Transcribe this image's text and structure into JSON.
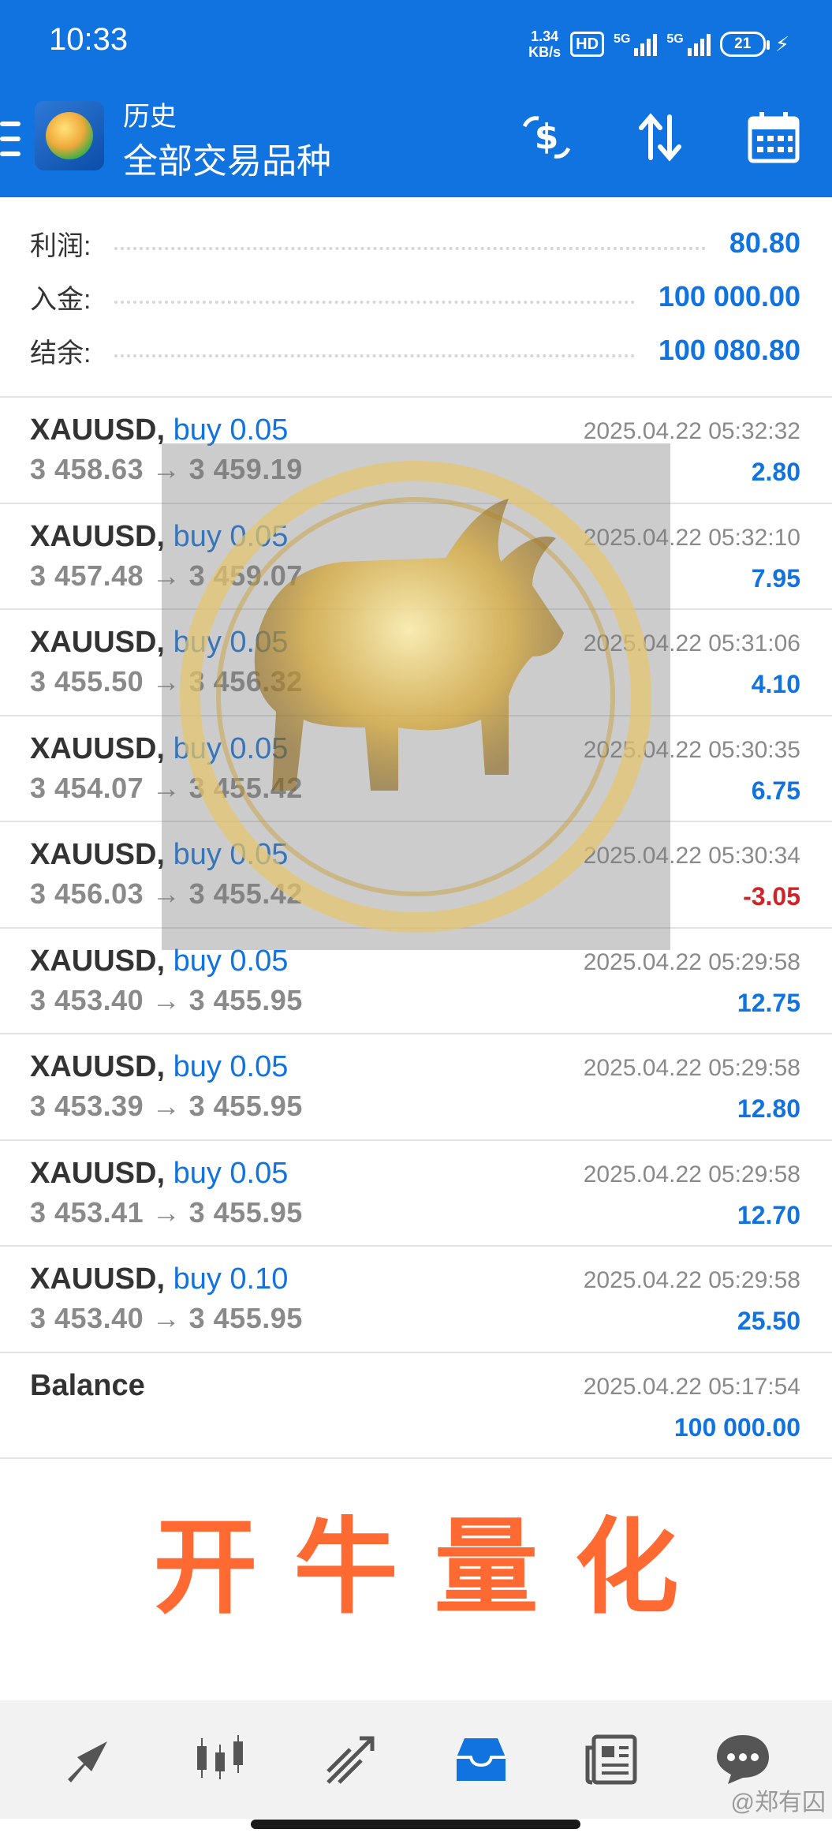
{
  "status": {
    "time": "10:33",
    "net_speed_value": "1.34",
    "net_speed_unit": "KB/s",
    "hd": "HD",
    "sim1": "5G",
    "sim2": "5G",
    "battery": "21"
  },
  "appbar": {
    "title_small": "历史",
    "title_main": "全部交易品种"
  },
  "summary": {
    "profit_label": "利润:",
    "profit_value": "80.80",
    "deposit_label": "入金:",
    "deposit_value": "100 000.00",
    "balance_label": "结余:",
    "balance_value": "100 080.80"
  },
  "deals": [
    {
      "symbol": "XAUUSD,",
      "side": "buy 0.05",
      "prices": "3 458.63 → 3 459.19",
      "time": "2025.04.22 05:32:32",
      "profit": "2.80"
    },
    {
      "symbol": "XAUUSD,",
      "side": "buy 0.05",
      "prices": "3 457.48 → 3 459.07",
      "time": "2025.04.22 05:32:10",
      "profit": "7.95"
    },
    {
      "symbol": "XAUUSD,",
      "side": "buy 0.05",
      "prices": "3 455.50 → 3 456.32",
      "time": "2025.04.22 05:31:06",
      "profit": "4.10"
    },
    {
      "symbol": "XAUUSD,",
      "side": "buy 0.05",
      "prices": "3 454.07 → 3 455.42",
      "time": "2025.04.22 05:30:35",
      "profit": "6.75"
    },
    {
      "symbol": "XAUUSD,",
      "side": "buy 0.05",
      "prices": "3 456.03 → 3 455.42",
      "time": "2025.04.22 05:30:34",
      "profit": "-3.05"
    },
    {
      "symbol": "XAUUSD,",
      "side": "buy 0.05",
      "prices": "3 453.40 → 3 455.95",
      "time": "2025.04.22 05:29:58",
      "profit": "12.75"
    },
    {
      "symbol": "XAUUSD,",
      "side": "buy 0.05",
      "prices": "3 453.39 → 3 455.95",
      "time": "2025.04.22 05:29:58",
      "profit": "12.80"
    },
    {
      "symbol": "XAUUSD,",
      "side": "buy 0.05",
      "prices": "3 453.41 → 3 455.95",
      "time": "2025.04.22 05:29:58",
      "profit": "12.70"
    },
    {
      "symbol": "XAUUSD,",
      "side": "buy 0.10",
      "prices": "3 453.40 → 3 455.95",
      "time": "2025.04.22 05:29:58",
      "profit": "25.50"
    },
    {
      "symbol": "Balance",
      "side": "",
      "prices": "",
      "time": "2025.04.22 05:17:54",
      "profit": "100 000.00"
    }
  ],
  "banner": "开牛量化",
  "watermark": "@郑有囚",
  "colors": {
    "primary": "#1173df",
    "loss": "#d0232a",
    "banner": "#ff6a33"
  },
  "icons": {
    "appbar": [
      "dollar-exchange-icon",
      "sort-icon",
      "calendar-icon"
    ],
    "bottom_nav": [
      "quotes-icon",
      "chart-icon",
      "trade-icon",
      "history-icon",
      "news-icon",
      "chat-icon"
    ]
  },
  "active_nav": "history"
}
